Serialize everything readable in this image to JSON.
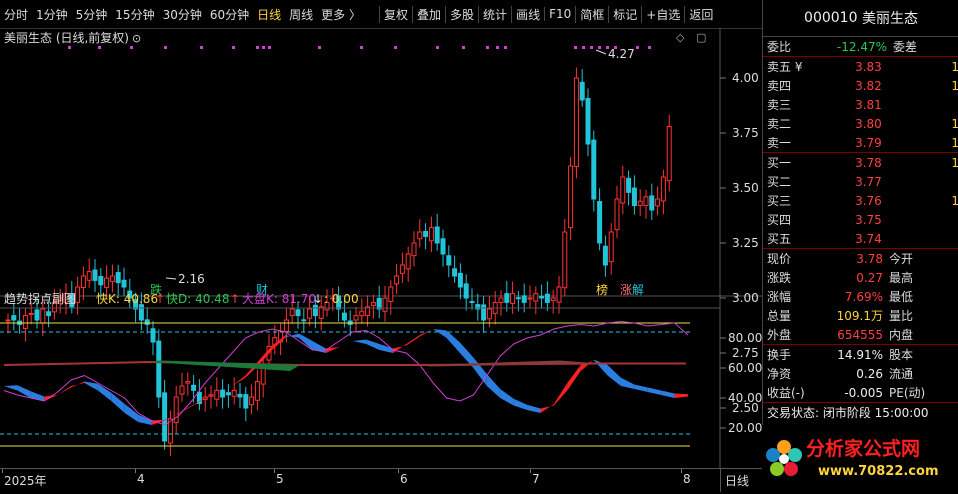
{
  "toolbar": {
    "periods": [
      "分时",
      "1分钟",
      "5分钟",
      "15分钟",
      "30分钟",
      "60分钟",
      "日线",
      "周线",
      "更多 〉"
    ],
    "active_period": "日线",
    "tools": [
      "复权",
      "叠加",
      "多股",
      "统计",
      "画线",
      "F10",
      "简框",
      "标记",
      "+自选",
      "返回"
    ]
  },
  "main_chart": {
    "title": "美丽生态 (日线,前复权)",
    "price_ticks": [
      "4.00",
      "3.75",
      "3.50",
      "3.25",
      "3.00",
      "2.75",
      "2.50"
    ],
    "high_label": "4.27",
    "low_label": "2.16",
    "markers": [
      "跌",
      "财",
      "榜",
      "涨",
      "解"
    ]
  },
  "sub_chart": {
    "title": "趋势拐点副图",
    "k_label": "快K: 40.86",
    "d_label": "快D: 40.48",
    "big_label": "大盘K: 81.70",
    "extra_label": ": 0.00",
    "ticks": [
      "80.00",
      "60.00",
      "40.00",
      "20.00"
    ]
  },
  "x_axis": {
    "labels": [
      "2025年",
      "4",
      "5",
      "6",
      "7",
      "8"
    ],
    "period": "日线"
  },
  "quote": {
    "code": "000010",
    "name": "美丽生态",
    "wb_label": "委比",
    "wb_value": "-12.47%",
    "wc_label": "委差",
    "asks": [
      {
        "label": "卖五 ¥",
        "price": "3.83",
        "vol": "1"
      },
      {
        "label": "卖四",
        "price": "3.82",
        "vol": "1"
      },
      {
        "label": "卖三",
        "price": "3.81",
        "vol": ""
      },
      {
        "label": "卖二",
        "price": "3.80",
        "vol": "1"
      },
      {
        "label": "卖一",
        "price": "3.79",
        "vol": "1"
      }
    ],
    "bids": [
      {
        "label": "买一",
        "price": "3.78",
        "vol": "1"
      },
      {
        "label": "买二",
        "price": "3.77",
        "vol": ""
      },
      {
        "label": "买三",
        "price": "3.76",
        "vol": "1"
      },
      {
        "label": "买四",
        "price": "3.75",
        "vol": ""
      },
      {
        "label": "买五",
        "price": "3.74",
        "vol": ""
      }
    ],
    "stats": [
      {
        "k": "现价",
        "v": "3.78",
        "k2": "今开",
        "cls": "red"
      },
      {
        "k": "涨跌",
        "v": "0.27",
        "k2": "最高",
        "cls": "red"
      },
      {
        "k": "涨幅",
        "v": "7.69%",
        "k2": "最低",
        "cls": "red"
      },
      {
        "k": "总量",
        "v": "109.1万",
        "k2": "量比",
        "cls": "yel"
      },
      {
        "k": "外盘",
        "v": "654555",
        "k2": "内盘",
        "cls": "red"
      }
    ],
    "stats2": [
      {
        "k": "换手",
        "v": "14.91%",
        "k2": "股本"
      },
      {
        "k": "净资",
        "v": "0.26",
        "k2": "流通"
      },
      {
        "k": "收益(-)",
        "v": "-0.005",
        "k2": "PE(动)"
      }
    ],
    "status": "交易状态: 闭市阶段 15:00:00"
  },
  "watermark": {
    "text": "分析家公式网",
    "url": "www.70822.com"
  },
  "colors": {
    "up": "#ff3333",
    "down": "#22c4d8",
    "axis": "#555555"
  }
}
